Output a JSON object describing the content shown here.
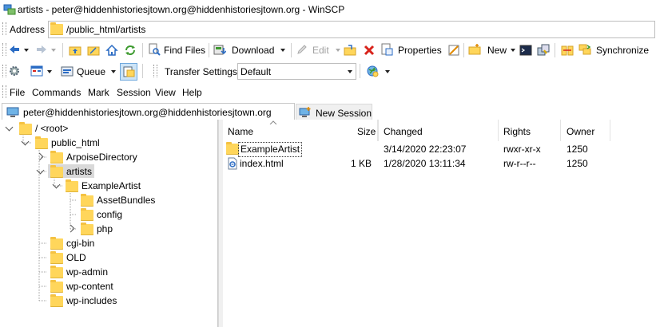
{
  "window": {
    "title": "artists - peter@hiddenhistoriesjtown.org@hiddenhistoriesjtown.org - WinSCP"
  },
  "addressbar": {
    "label": "Address",
    "path": "/public_html/artists"
  },
  "toolbar1": {
    "find_files": "Find Files",
    "download": "Download",
    "edit": "Edit",
    "properties": "Properties",
    "new": "New",
    "synchronize": "Synchronize"
  },
  "toolbar2": {
    "queue": "Queue",
    "transfer_settings_label": "Transfer Settings",
    "transfer_settings_value": "Default"
  },
  "menu": [
    "File",
    "Commands",
    "Mark",
    "Session",
    "View",
    "Help"
  ],
  "tabs": {
    "session": "peter@hiddenhistoriesjtown.org@hiddenhistoriesjtown.org",
    "new_session": "New Session"
  },
  "tree": [
    {
      "label": "/ <root>"
    },
    {
      "label": "public_html"
    },
    {
      "label": "ArpoiseDirectory"
    },
    {
      "label": "artists"
    },
    {
      "label": "ExampleArtist"
    },
    {
      "label": "AssetBundles"
    },
    {
      "label": "config"
    },
    {
      "label": "php"
    },
    {
      "label": "cgi-bin"
    },
    {
      "label": "OLD"
    },
    {
      "label": "wp-admin"
    },
    {
      "label": "wp-content"
    },
    {
      "label": "wp-includes"
    }
  ],
  "filelist": {
    "columns": [
      "Name",
      "Size",
      "Changed",
      "Rights",
      "Owner"
    ],
    "rows": [
      {
        "name": "ExampleArtist",
        "size": "",
        "changed": "3/14/2020 22:23:07",
        "rights": "rwxr-xr-x",
        "owner": "1250",
        "icon": "folder-icon"
      },
      {
        "name": "index.html",
        "size": "1 KB",
        "changed": "1/28/2020 13:11:34",
        "rights": "rw-r--r--",
        "owner": "1250",
        "icon": "html-file-icon"
      }
    ]
  },
  "colors": {
    "folder": "#ffd65b",
    "selection": "#cce4f7",
    "accent": "#2b6cc4"
  }
}
